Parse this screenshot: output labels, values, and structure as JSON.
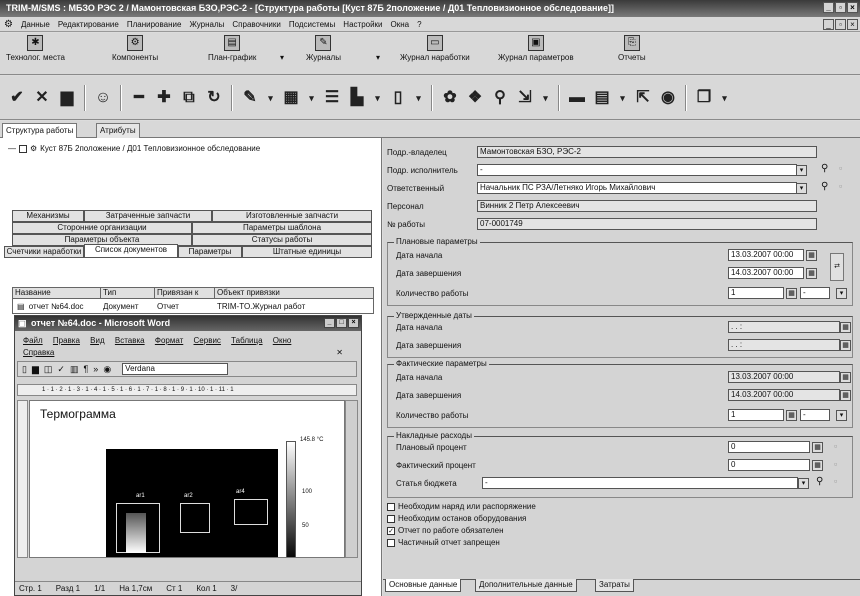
{
  "window": {
    "title": "TRIM-M/SMS : МБЗО РЭС 2 / Мамонтовская БЗО,РЭС-2 - [Структура работы [Куст 87Б 2положение / Д01 Тепловизионное обследование]]"
  },
  "menu": [
    "Данные",
    "Редактирование",
    "Планирование",
    "Журналы",
    "Справочники",
    "Подсистемы",
    "Настройки",
    "Окна",
    "?"
  ],
  "bigtoolbar": {
    "buttons": [
      "Технолог. места",
      "Компоненты",
      "План-график",
      "Журналы",
      "Журнал наработки",
      "Журнал параметров",
      "Отчеты"
    ]
  },
  "toptabs": [
    "Структура работы",
    "Атрибуты"
  ],
  "tree": {
    "item": "Куст 87Б 2положение / Д01 Тепловизионное обследование"
  },
  "lefttabs": {
    "row1": [
      "Механизмы",
      "Затраченные запчасти",
      "Изготовленные запчасти"
    ],
    "row2": [
      "Сторонние организации",
      "Параметры шаблона"
    ],
    "row3": [
      "Параметры объекта",
      "Статусы работы"
    ],
    "row4": [
      "Счетчики наработки",
      "Список документов",
      "Параметры",
      "Штатные единицы"
    ]
  },
  "doctable": {
    "headers": [
      "Название",
      "Тип",
      "Привязан к",
      "Объект привязки"
    ],
    "rows": [
      [
        "отчет №64.doc",
        "Документ",
        "Отчет",
        "TRIM-TO.Журнал работ"
      ]
    ]
  },
  "word": {
    "title": "отчет №64.doc - Microsoft Word",
    "menu": [
      "Файл",
      "Правка",
      "Вид",
      "Вставка",
      "Формат",
      "Сервис",
      "Таблица",
      "Окно",
      "Справка"
    ],
    "font": "Verdana",
    "ruler": "1 · 1 · 2 · 1 · 3 · 1 · 4 · 1 · 5 · 1 · 6 · 1 · 7 · 1 · 8 · 1 · 9 · 1 · 10 · 1 · 11 · 1",
    "heading": "Термограмма",
    "scale_max": "145.8 °C",
    "scale_mid": "100",
    "scale_low": "50",
    "rois": [
      "ar1",
      "ar2",
      "ar4"
    ],
    "status": [
      "Стр. 1",
      "Разд 1",
      "1/1",
      "На 1,7см",
      "Ст 1",
      "Кол 1",
      "3/"
    ]
  },
  "form": {
    "owner_label": "Подр.-владелец",
    "owner": "Мамонтовская БЗО, РЭС-2",
    "executor_label": "Подр. исполнитель",
    "executor": "-",
    "responsible_label": "Ответственный",
    "responsible": "Начальник ПС РЗА/Летняко Игорь Михайлович",
    "personnel_label": "Персонал",
    "personnel": "Винник 2 Петр Алексеевич",
    "worknum_label": "№ работы",
    "worknum": "07-0001749",
    "planned": {
      "title": "Плановые параметры",
      "start_label": "Дата начала",
      "start": "13.03.2007 00:00",
      "end_label": "Дата завершения",
      "end": "14.03.2007 00:00",
      "qty_label": "Количество работы",
      "qty": "1",
      "qty_unit": "-"
    },
    "approved": {
      "title": "Утвержденные даты",
      "start_label": "Дата начала",
      "start": ". .   :",
      "end_label": "Дата завершения",
      "end": ". .   :"
    },
    "actual": {
      "title": "Фактические параметры",
      "start_label": "Дата начала",
      "start": "13.03.2007 00:00",
      "end_label": "Дата завершения",
      "end": "14.03.2007 00:00",
      "qty_label": "Количество работы",
      "qty": "1",
      "qty_unit": "-"
    },
    "overhead": {
      "title": "Накладные расходы",
      "plan_label": "Плановый процент",
      "plan": "0",
      "fact_label": "Фактический процент",
      "fact": "0",
      "budget_label": "Статья бюджета",
      "budget": "-"
    },
    "checks": [
      {
        "label": "Необходим наряд или распоряжение",
        "checked": ""
      },
      {
        "label": "Необходим останов оборудования",
        "checked": ""
      },
      {
        "label": "Отчет по работе обязателен",
        "checked": "✓"
      },
      {
        "label": "Частичный отчет запрещен",
        "checked": ""
      }
    ]
  },
  "bottomtabs": [
    "Основные данные",
    "Дополнительные данные",
    "Затраты"
  ]
}
